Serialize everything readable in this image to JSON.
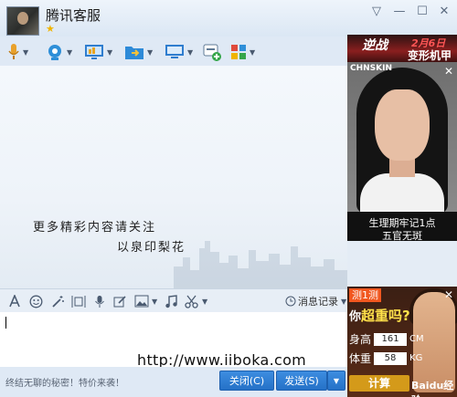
{
  "window": {
    "title": "腾讯客服",
    "controls": {
      "menu": "▽",
      "minimize": "—",
      "maximize": "☐",
      "close": "✕"
    }
  },
  "toolbar": {
    "icons": [
      "microphone-icon",
      "video-call-icon",
      "screen-share-icon",
      "file-transfer-icon",
      "remote-desktop-icon",
      "app-add-icon",
      "apps-grid-icon"
    ]
  },
  "chat": {
    "note_line1": "更多精彩内容请关注",
    "note_line2": "以泉印梨花"
  },
  "format_bar": {
    "icons": [
      "font-icon",
      "emoji-icon",
      "magic-icon",
      "screenshot-icon",
      "voice-icon",
      "edit-icon",
      "image-icon",
      "music-icon",
      "scissors-icon"
    ],
    "history_label": "消息记录"
  },
  "input": {
    "watermark": "http://www.iiboka.com"
  },
  "footer": {
    "tip": "终结无聊的秘密！特价来袭！",
    "close_label": "关闭(C)",
    "send_label": "发送(S)"
  },
  "ads": {
    "top": {
      "title": "逆战",
      "date": "2月6日",
      "subtitle": "变形机甲"
    },
    "middle": {
      "brand": "CHNSKIN",
      "caption1": "生理期牢记1点",
      "caption2": "五官无斑",
      "close": "✕"
    },
    "bottom": {
      "tag": "测1测",
      "headline_prefix": "你",
      "headline_em": "超重吗?",
      "height_label": "身高",
      "height_value": "161",
      "height_unit": "CM",
      "weight_label": "体重",
      "weight_value": "58",
      "weight_unit": "KG",
      "calc_label": "计算",
      "brand": "Baidu经验",
      "close": "✕"
    }
  },
  "colors": {
    "window_bg": "#dfe9f5",
    "button_blue": "#2a78cf",
    "star": "#f0b400"
  }
}
